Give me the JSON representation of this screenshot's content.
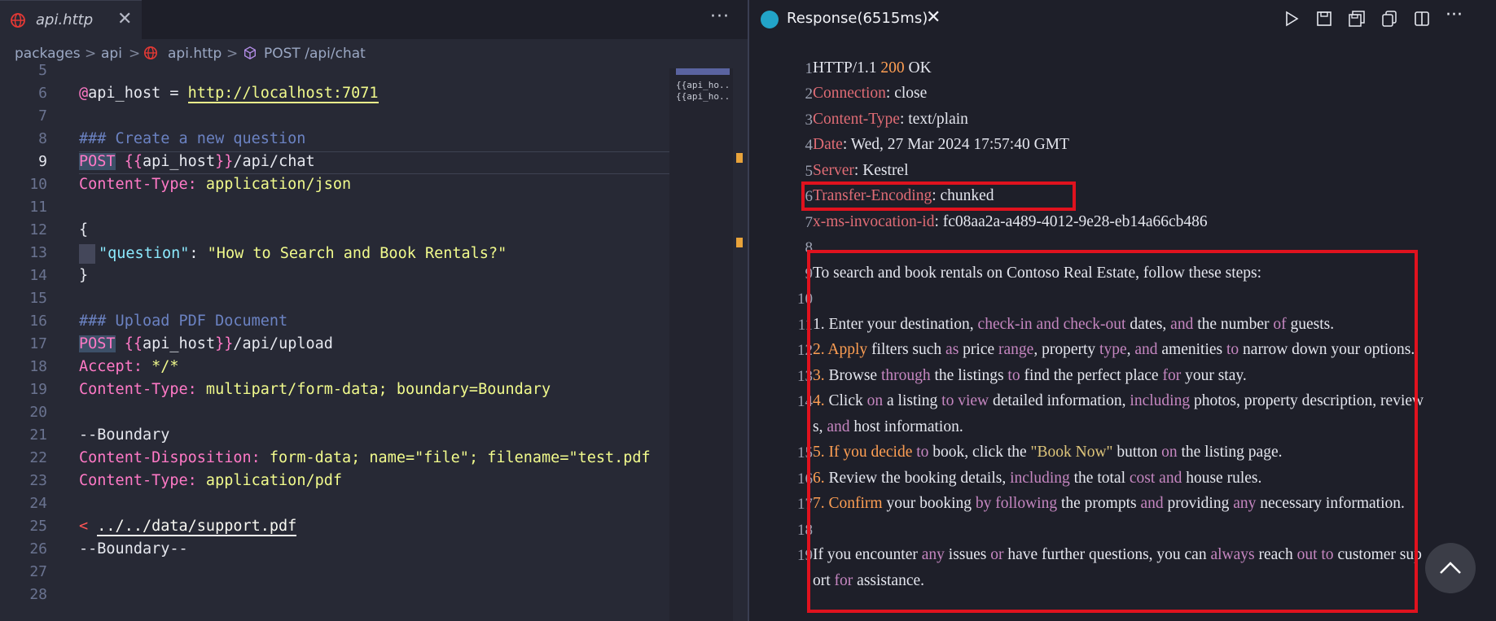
{
  "left_pane": {
    "tab": {
      "filename": "api.http",
      "icon": "globe-icon"
    },
    "more_label": "···",
    "breadcrumb": [
      "packages",
      "api",
      "api.http",
      "POST /api/chat"
    ],
    "breadcrumb_sep": ">",
    "line_numbers": [
      "5",
      "6",
      "7",
      "8",
      "9",
      "10",
      "11",
      "12",
      "13",
      "14",
      "15",
      "16",
      "17",
      "18",
      "19",
      "20",
      "21",
      "22",
      "23",
      "24",
      "25",
      "26",
      "27",
      "28"
    ],
    "active_line": "9",
    "code": {
      "l6_at": "@",
      "l6_var": "api_host",
      "l6_eq": " = ",
      "l6_url": "http://localhost:7071",
      "l8": "### Create a new question",
      "l9_method": "POST",
      "l9_open": "{{",
      "l9_var": "api_host",
      "l9_close": "}}",
      "l9_path": "/api/chat",
      "l10_h": "Content-Type:",
      "l10_v": " application/json",
      "l12": "{",
      "l13_key": "\"question\"",
      "l13_colon": ": ",
      "l13_val": "\"How to Search and Book Rentals?\"",
      "l14": "}",
      "l16": "### Upload PDF Document",
      "l17_method": "POST",
      "l17_open": "{{",
      "l17_var": "api_host",
      "l17_close": "}}",
      "l17_path": "/api/upload",
      "l18_h": "Accept:",
      "l18_v": " */*",
      "l19_h": "Content-Type:",
      "l19_v": " multipart/form-data; boundary=Boundary",
      "l21": "--Boundary",
      "l22_h": "Content-Disposition:",
      "l22_v": " form-data; name=\"file\"; filename=\"test.pdf",
      "l23_h": "Content-Type:",
      "l23_v": " application/pdf",
      "l25_lt": "<",
      "l25_path": "../../data/support.pdf",
      "l26": "--Boundary--"
    },
    "minimap": [
      "{{api_ho...ap",
      "{{api_ho...i/"
    ]
  },
  "right_pane": {
    "tab_title": "Response(6515ms)",
    "actions": [
      "play-icon",
      "save-icon",
      "save-all-icon",
      "copy-icon",
      "split-editor-icon",
      "more-icon"
    ],
    "more_label": "···",
    "line_numbers": [
      "1",
      "2",
      "3",
      "4",
      "5",
      "6",
      "7",
      "8",
      "9",
      "10",
      "11",
      "12",
      "13",
      "14",
      "",
      "15",
      "16",
      "17",
      "18",
      "19",
      ""
    ],
    "status": {
      "proto": "HTTP/1.1 ",
      "code": "200",
      "text": " OK"
    },
    "headers": [
      {
        "name": "Connection",
        "value": ": close"
      },
      {
        "name": "Content-Type",
        "value": ": text/plain"
      },
      {
        "name": "Date",
        "value": ": Wed, 27 Mar 2024 17:57:40 GMT"
      },
      {
        "name": "Server",
        "value": ": Kestrel"
      },
      {
        "name": "Transfer-Encoding",
        "value": ": chunked"
      },
      {
        "name": "x-ms-invocation-id",
        "value": ": fc08aa2a-a489-4012-9e28-eb14a66cb486"
      }
    ],
    "body": {
      "intro": "To search and book rentals on Contoso Real Estate, follow these steps:",
      "s1": [
        "1. Enter your destination, ",
        "check-in and check-out",
        " dates, ",
        "and",
        " the number ",
        "of",
        " guests."
      ],
      "s2": [
        "2. Apply",
        " filters such ",
        "as",
        " price ",
        "range",
        ", property ",
        "type",
        ", ",
        "and",
        " amenities ",
        "to",
        " narrow down your options."
      ],
      "s3": [
        "3.",
        " Browse ",
        "through",
        " the listings ",
        "to",
        " find the perfect place ",
        "for",
        " your stay."
      ],
      "s4a": [
        "4.",
        " Click ",
        "on",
        " a listing ",
        "to view",
        " detailed information, ",
        "including",
        " photos, property description, review"
      ],
      "s4b": [
        "s, ",
        "and",
        " host information."
      ],
      "s5": [
        "5. If you decide ",
        "to",
        " book, click the ",
        "\"Book Now\"",
        " button ",
        "on",
        " the listing page."
      ],
      "s6": [
        "6.",
        " Review the booking details, ",
        "including",
        " the total ",
        "cost",
        " ",
        "and",
        " house rules."
      ],
      "s7": [
        "7. Confirm",
        " your booking ",
        "by following",
        " the prompts ",
        "and",
        " providing ",
        "any",
        " necessary information."
      ],
      "outro_a": [
        "If you encounter ",
        "any",
        " issues ",
        "or",
        " have further questions, you can ",
        "always",
        " reach ",
        "out to",
        " customer sup"
      ],
      "outro_b": [
        "ort ",
        "for",
        " assistance."
      ]
    }
  }
}
